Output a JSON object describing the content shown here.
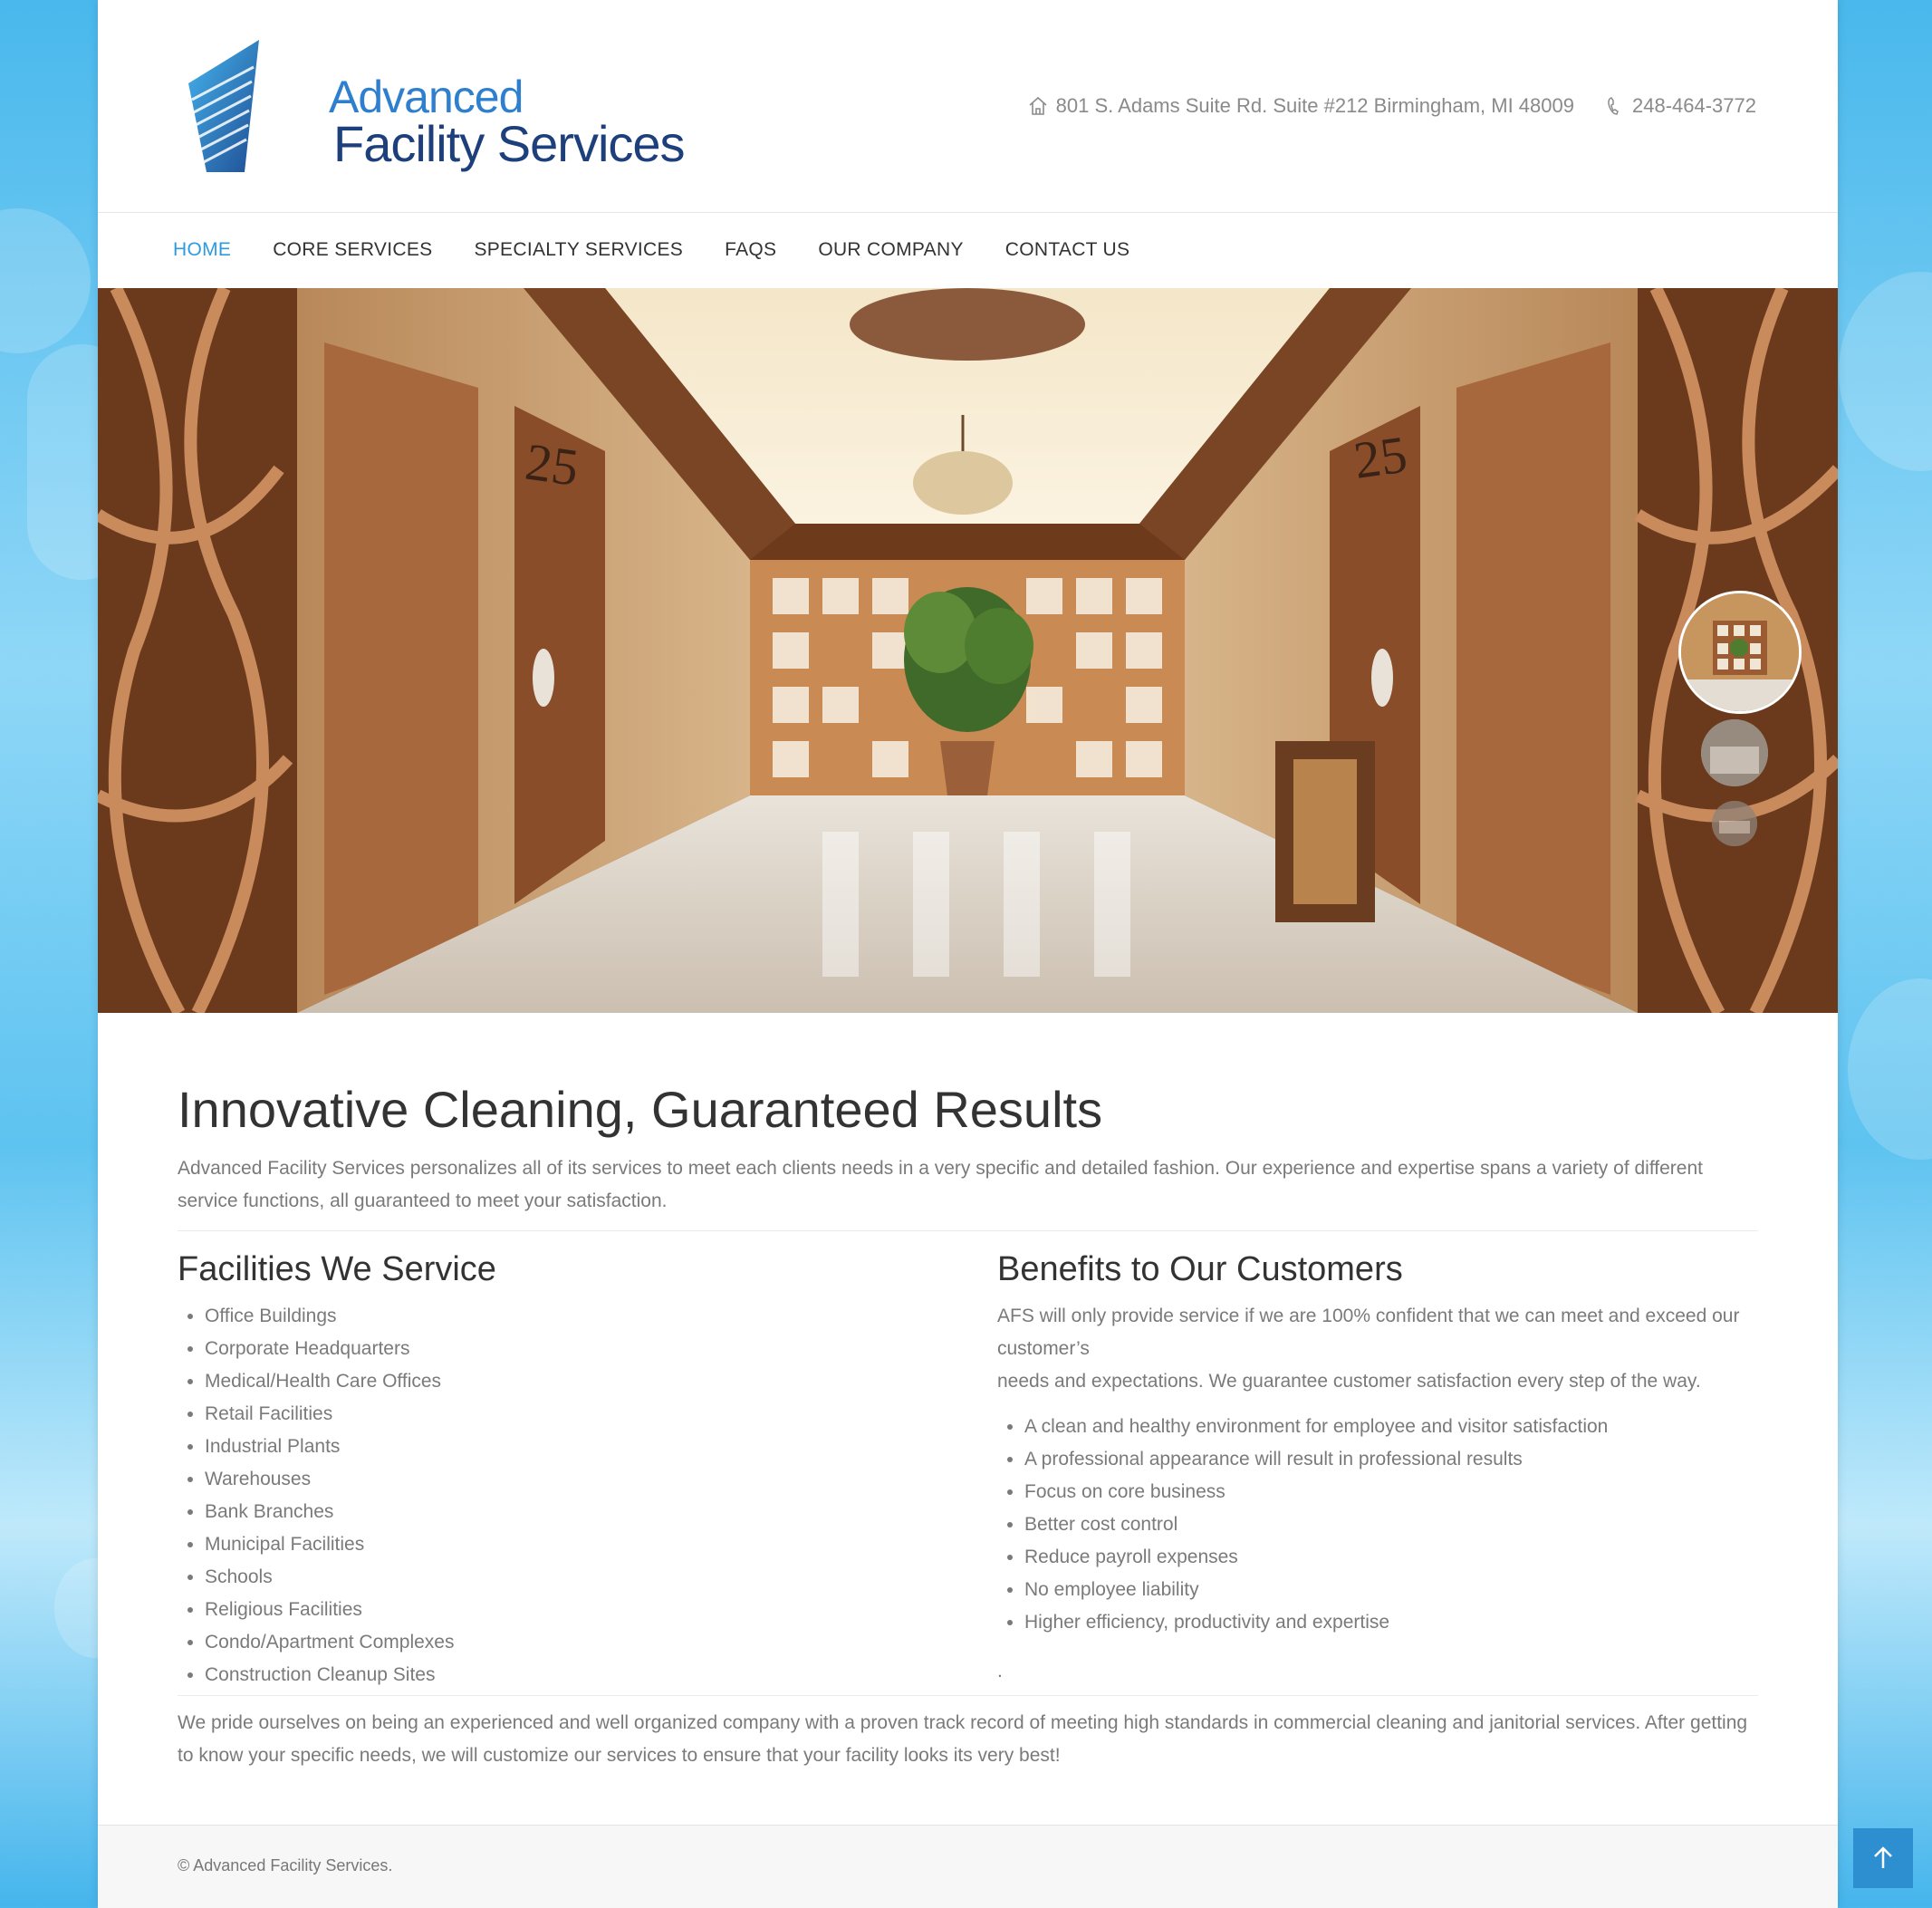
{
  "colors": {
    "accent": "#2e9ae0",
    "heading": "#333333",
    "body_text": "#7a7a7a",
    "logo_light": "#2f7fcf",
    "logo_dark": "#1d3f7c",
    "scroll_button": "#2e8fd0"
  },
  "header": {
    "logo": {
      "line1": "Advanced",
      "line2": "Facility Services"
    },
    "address_icon": "home-icon",
    "address": "801 S. Adams Suite Rd. Suite #212 Birmingham, MI 48009",
    "phone_icon": "phone-icon",
    "phone": "248-464-3772"
  },
  "nav": {
    "items": [
      {
        "label": "HOME",
        "active": true
      },
      {
        "label": "CORE SERVICES",
        "active": false
      },
      {
        "label": "SPECIALTY SERVICES",
        "active": false
      },
      {
        "label": "FAQS",
        "active": false
      },
      {
        "label": "OUR COMPANY",
        "active": false
      },
      {
        "label": "CONTACT US",
        "active": false
      }
    ]
  },
  "hero": {
    "sign_left": "25",
    "sign_right": "25"
  },
  "main": {
    "title": "Innovative Cleaning, Guaranteed Results",
    "intro": "Advanced Facility Services personalizes all of its services to meet each clients needs in a very specific and detailed fashion. Our experience and expertise spans a variety of different service functions, all guaranteed to meet your satisfaction.",
    "facilities": {
      "heading": "Facilities We Service",
      "items": [
        "Office Buildings",
        "Corporate Headquarters",
        "Medical/Health Care Offices",
        "Retail Facilities",
        "Industrial Plants",
        "Warehouses",
        "Bank Branches",
        "Municipal Facilities",
        "Schools",
        "Religious Facilities",
        "Condo/Apartment Complexes",
        "Construction Cleanup Sites"
      ]
    },
    "benefits": {
      "heading": "Benefits to Our Customers",
      "text_line1": "AFS will only provide service if we are 100% confident that we can meet and exceed our customer’s",
      "text_line2": "needs and expectations. We guarantee customer satisfaction every step of the way.",
      "items": [
        "A clean and healthy environment for employee and visitor satisfaction",
        "A professional appearance will result in professional results",
        "Focus on core business",
        "Better cost control",
        "Reduce payroll expenses",
        "No employee liability",
        "Higher efficiency, productivity and expertise"
      ],
      "trailing": "."
    },
    "closing": "We pride ourselves on being an experienced and well organized company with a proven track record of meeting high standards in commercial cleaning and janitorial services. After getting to know your specific needs, we will customize our services to ensure that your facility looks its very best!"
  },
  "footer": {
    "copyright": "© Advanced Facility Services."
  },
  "scroll_top_icon": "arrow-up-icon"
}
